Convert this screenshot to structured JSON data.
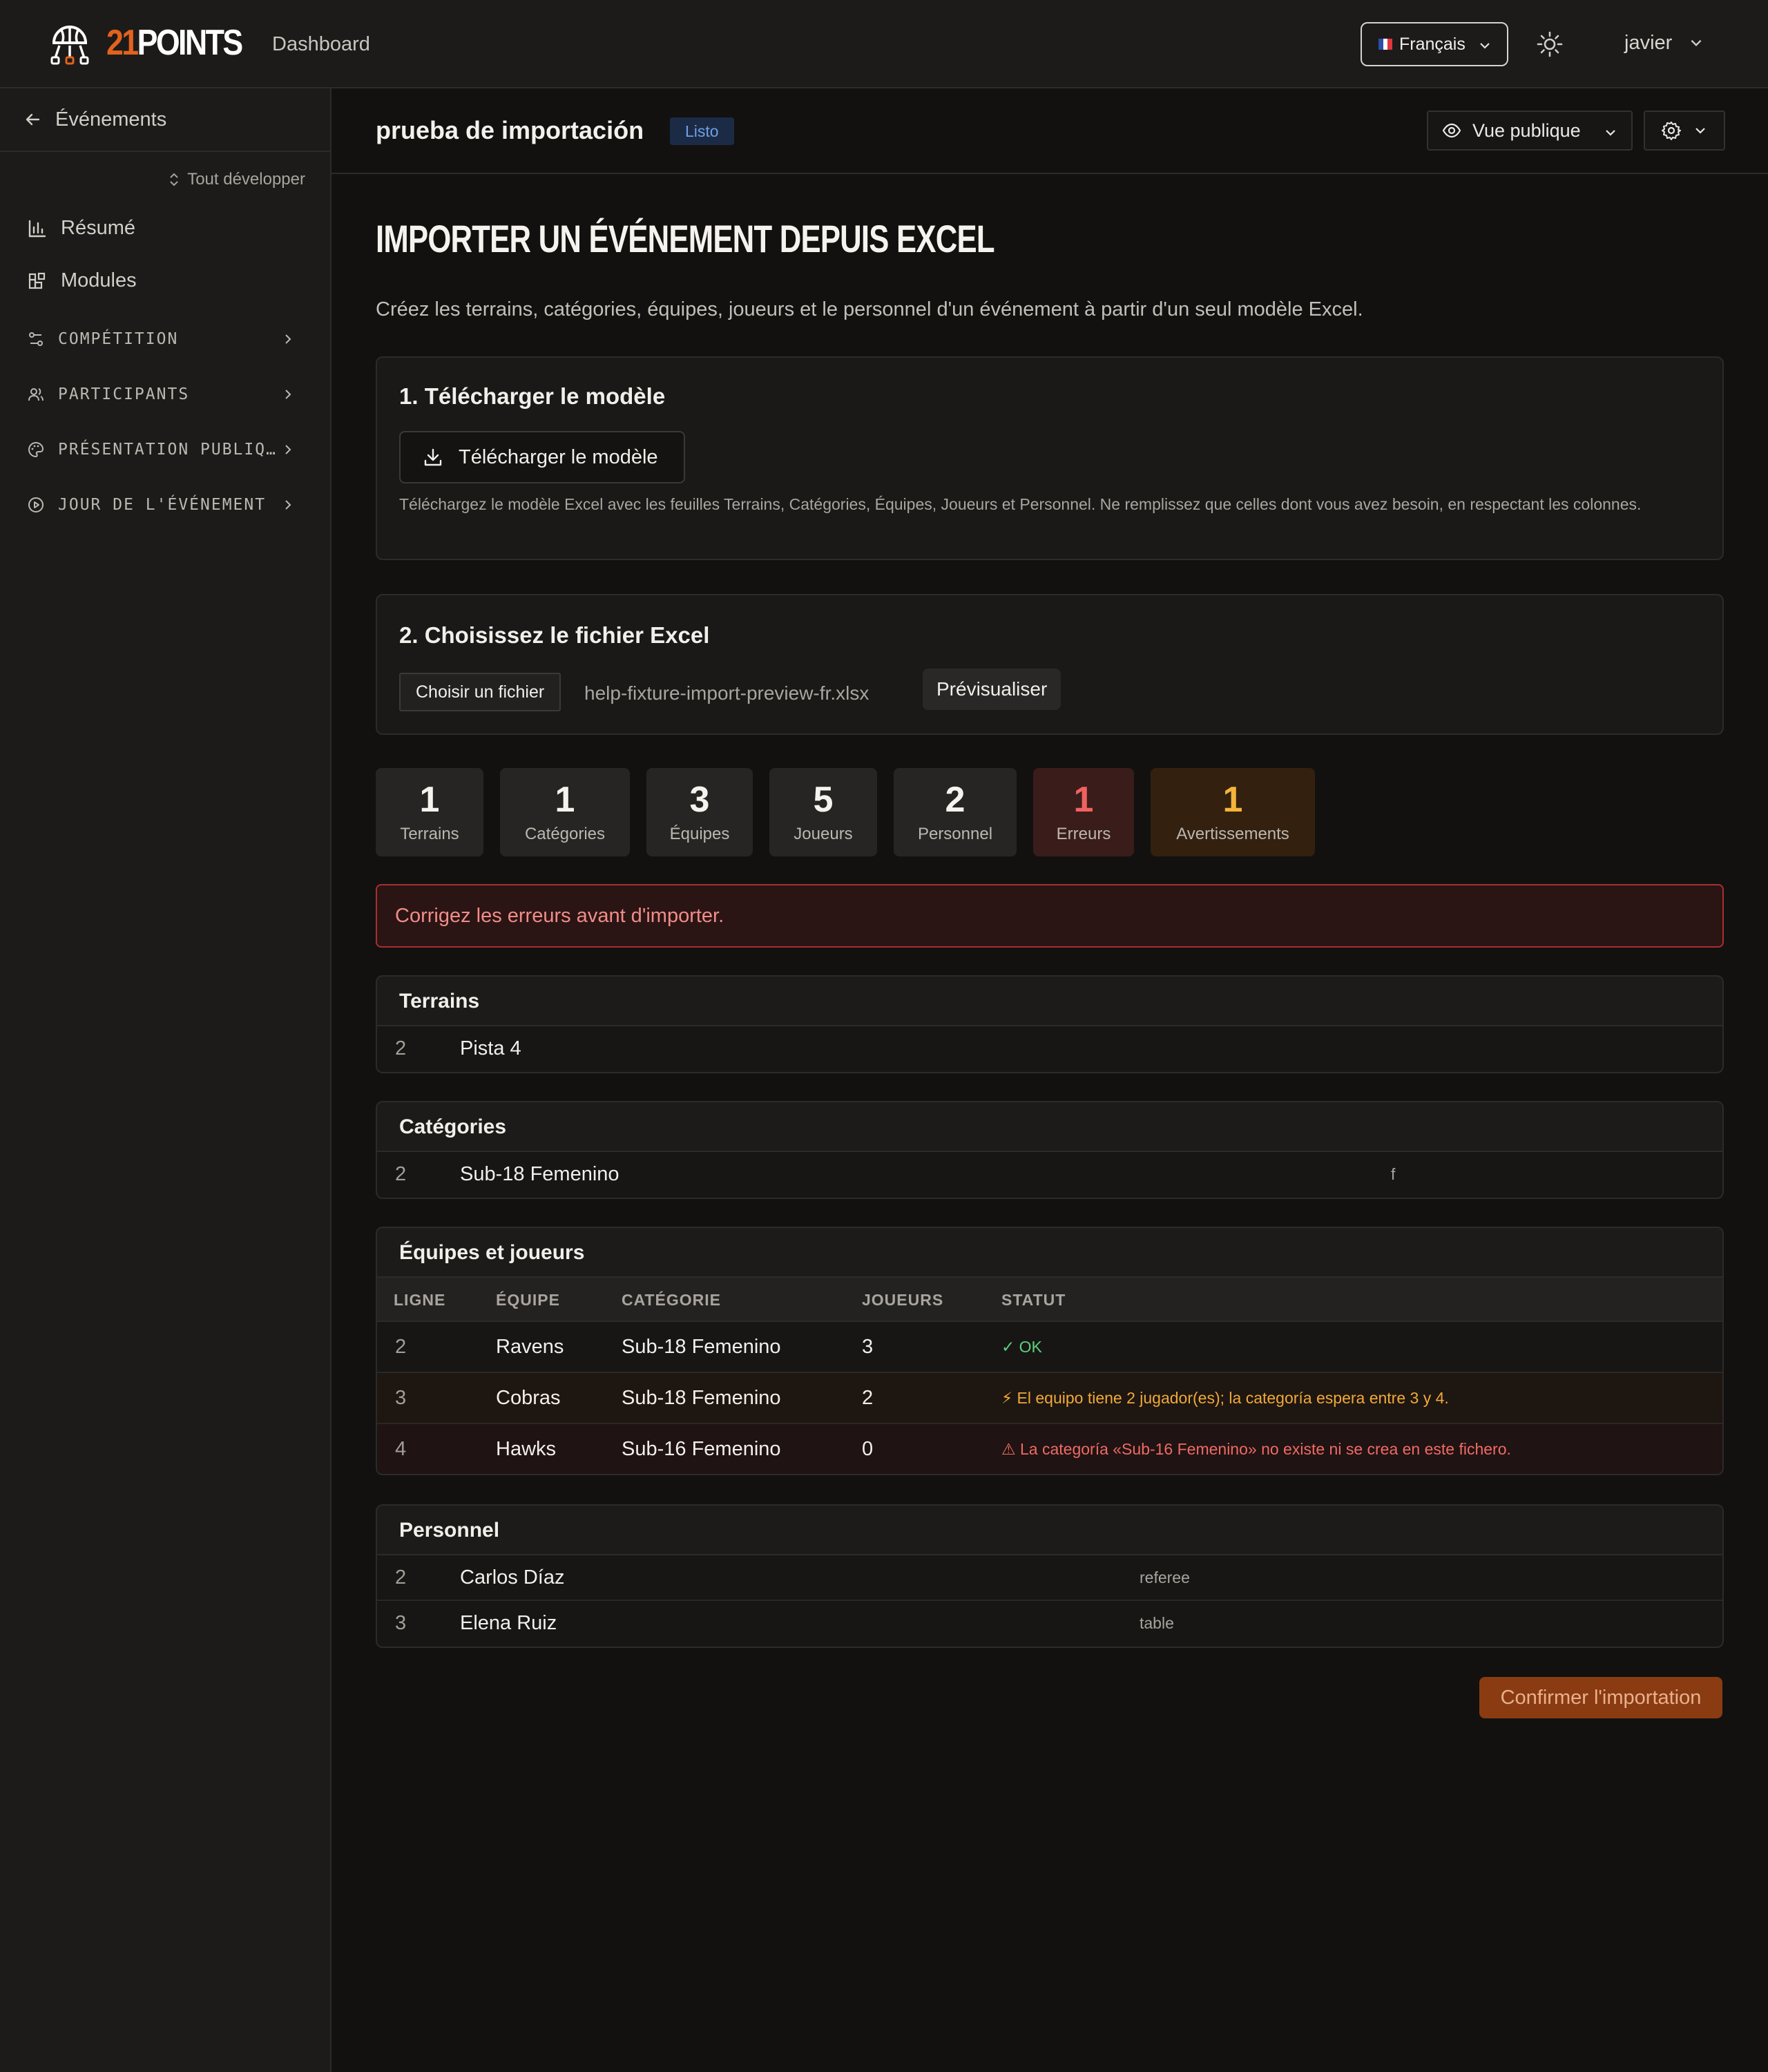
{
  "header": {
    "logo_num": "21",
    "logo_word": "POINTS",
    "nav_dashboard": "Dashboard",
    "language": "Français",
    "user": "javier"
  },
  "sidebar": {
    "back": "Événements",
    "expand_all": "Tout développer",
    "items": [
      {
        "label": "Résumé",
        "icon": "bar-chart-icon"
      },
      {
        "label": "Modules",
        "icon": "modules-icon"
      }
    ],
    "sections": [
      {
        "label": "COMPÉTITION",
        "icon": "competition-icon"
      },
      {
        "label": "PARTICIPANTS",
        "icon": "users-icon"
      },
      {
        "label": "PRÉSENTATION PUBLIQ…",
        "icon": "palette-icon"
      },
      {
        "label": "JOUR DE L'ÉVÉNEMENT",
        "icon": "play-icon"
      }
    ]
  },
  "event": {
    "title": "prueba de importación",
    "status": "Listo",
    "public_view": "Vue publique"
  },
  "page": {
    "title": "IMPORTER UN ÉVÉNEMENT DEPUIS EXCEL",
    "description": "Créez les terrains, catégories, équipes, joueurs et le personnel d'un événement à partir d'un seul modèle Excel."
  },
  "step1": {
    "title": "1. Télécharger le modèle",
    "button": "Télécharger le modèle",
    "note": "Téléchargez le modèle Excel avec les feuilles Terrains, Catégories, Équipes, Joueurs et Personnel. Ne remplissez que celles dont vous avez besoin, en respectant les colonnes."
  },
  "step2": {
    "title": "2. Choisissez le fichier Excel",
    "choose_button": "Choisir un fichier",
    "file_name": "help-fixture-import-preview-fr.xlsx",
    "preview_button": "Prévisualiser"
  },
  "stats": [
    {
      "value": "1",
      "label": "Terrains"
    },
    {
      "value": "1",
      "label": "Catégories"
    },
    {
      "value": "3",
      "label": "Équipes"
    },
    {
      "value": "5",
      "label": "Joueurs"
    },
    {
      "value": "2",
      "label": "Personnel"
    },
    {
      "value": "1",
      "label": "Erreurs"
    },
    {
      "value": "1",
      "label": "Avertissements"
    }
  ],
  "alert": "Corrigez les erreurs avant d'importer.",
  "fields": {
    "title": "Terrains",
    "rows": [
      {
        "line": "2",
        "name": "Pista 4"
      }
    ]
  },
  "categories": {
    "title": "Catégories",
    "rows": [
      {
        "line": "2",
        "name": "Sub-18 Femenino",
        "gender": "f"
      }
    ]
  },
  "teams": {
    "title": "Équipes et joueurs",
    "columns": [
      "LIGNE",
      "ÉQUIPE",
      "CATÉGORIE",
      "JOUEURS",
      "STATUT"
    ],
    "rows": [
      {
        "line": "2",
        "team": "Ravens",
        "category": "Sub-18 Femenino",
        "players": "3",
        "status": "✓ OK"
      },
      {
        "line": "3",
        "team": "Cobras",
        "category": "Sub-18 Femenino",
        "players": "2",
        "status": "⚡ El equipo tiene 2 jugador(es); la categoría espera entre 3 y 4."
      },
      {
        "line": "4",
        "team": "Hawks",
        "category": "Sub-16 Femenino",
        "players": "0",
        "status": "⚠ La categoría «Sub-16 Femenino» no existe ni se crea en este fichero."
      }
    ]
  },
  "staff": {
    "title": "Personnel",
    "rows": [
      {
        "line": "2",
        "name": "Carlos Díaz",
        "role": "referee"
      },
      {
        "line": "3",
        "name": "Elena Ruiz",
        "role": "table"
      }
    ]
  },
  "confirm_button": "Confirmer l'importation",
  "colors": {
    "accent": "#e2621e",
    "background": "#121110",
    "error": "#f0625f",
    "warning": "#f3b43a",
    "ok": "#5fd07a"
  }
}
